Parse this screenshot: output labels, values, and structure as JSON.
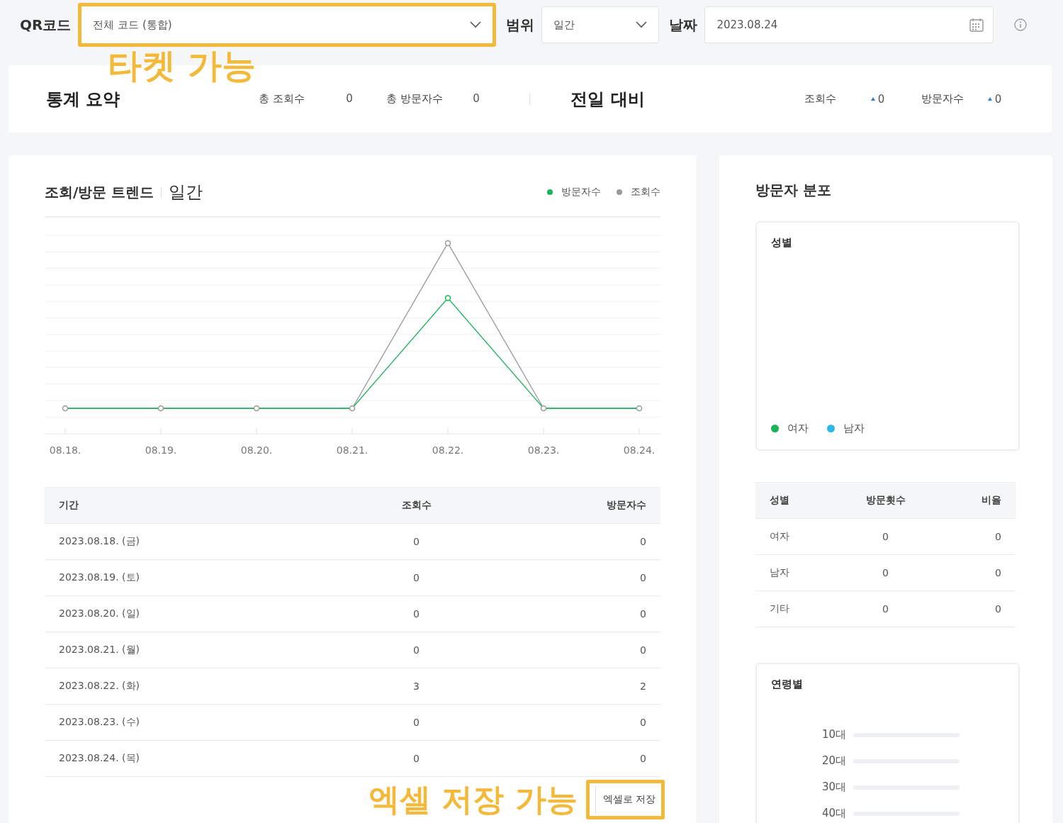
{
  "filters": [
    {
      "label": "QR코드",
      "kind": "select",
      "value": "전체 코드 (통합)",
      "highlighted": true
    },
    {
      "label": "범위",
      "kind": "select",
      "value": "일간",
      "highlighted": false
    },
    {
      "label": "날짜",
      "kind": "date",
      "value": "2023.08.24",
      "highlighted": false
    }
  ],
  "summary": {
    "title": "통계 요약",
    "stats": [
      {
        "label": "총 조회수",
        "value": "0"
      },
      {
        "label": "총 방문자수",
        "value": "0"
      }
    ],
    "compare_title": "전일 대비",
    "changes": [
      {
        "label": "조회수",
        "increase": true,
        "value": "0"
      },
      {
        "label": "방문자수",
        "increase": true,
        "value": "0"
      }
    ]
  },
  "trend": {
    "title": "조회/방문 트렌드",
    "period": "일간",
    "legend": [
      {
        "label": "방문자수",
        "color": "#19b35a"
      },
      {
        "label": "조회수",
        "color": "#9a9a9a"
      }
    ],
    "x_labels": [
      "08.18.",
      "08.19.",
      "08.20.",
      "08.21.",
      "08.22.",
      "08.23.",
      "08.24."
    ],
    "table": {
      "columns": [
        "기간",
        "조회수",
        "방문자수"
      ],
      "rows": [
        [
          "2023.08.18. (금)",
          "0",
          "0"
        ],
        [
          "2023.08.19. (토)",
          "0",
          "0"
        ],
        [
          "2023.08.20. (일)",
          "0",
          "0"
        ],
        [
          "2023.08.21. (월)",
          "0",
          "0"
        ],
        [
          "2023.08.22. (화)",
          "3",
          "2"
        ],
        [
          "2023.08.23. (수)",
          "0",
          "0"
        ],
        [
          "2023.08.24. (목)",
          "0",
          "0"
        ]
      ]
    },
    "export_button": "엑셀로 저장"
  },
  "distribution": {
    "title": "방문자 분포",
    "gender_title": "성별",
    "gender_legend": [
      {
        "label": "여자",
        "color": "#19b35a"
      },
      {
        "label": "남자",
        "color": "#2bb8e6"
      }
    ],
    "gender_table": {
      "columns": [
        "성별",
        "방문횟수",
        "비율"
      ],
      "rows": [
        [
          "여자",
          "0",
          "0"
        ],
        [
          "남자",
          "0",
          "0"
        ],
        [
          "기타",
          "0",
          "0"
        ]
      ]
    },
    "age_title": "연령별",
    "age_labels": [
      "10대",
      "20대",
      "30대",
      "40대"
    ]
  },
  "annotations": [
    {
      "text": "타켓 가능",
      "kind": "filter"
    },
    {
      "text": "엑셀 저장 가능",
      "kind": "export"
    }
  ]
}
